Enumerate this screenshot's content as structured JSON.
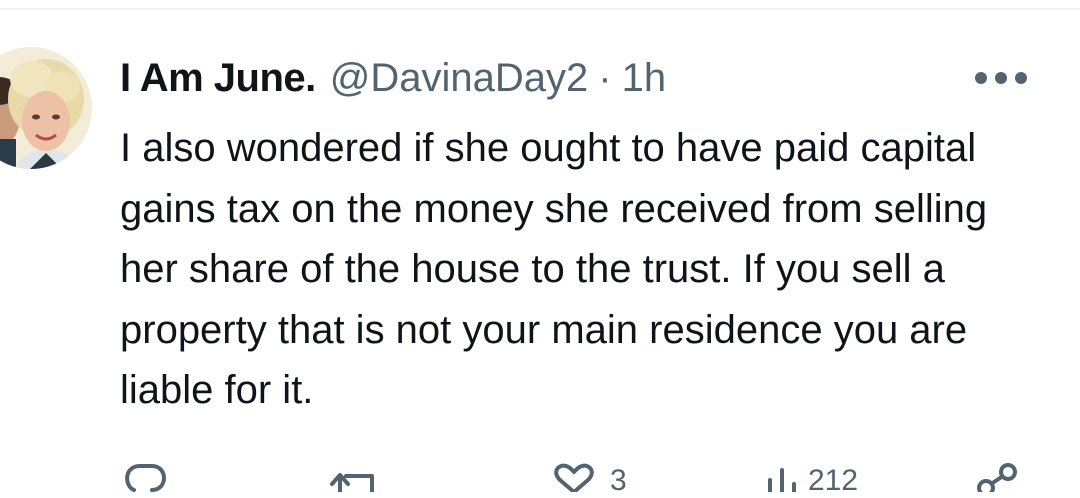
{
  "tweet": {
    "display_name": "I Am June.",
    "handle": "@DavinaDay2",
    "separator": "·",
    "time": "1h",
    "text": "I also wondered if she ought to have paid capital gains tax on the money she received from selling her share of the house to the trust. If you sell a property that is not your main residence you are liable for it."
  },
  "actions": {
    "reply_icon": "reply-icon",
    "retweet_icon": "retweet-icon",
    "like_icon": "heart-icon",
    "like_count": "3",
    "views_icon": "views-icon",
    "views_count": "212",
    "share_icon": "share-icon"
  },
  "colors": {
    "text": "#0f1419",
    "secondary": "#536471",
    "divider": "#eff3f4"
  }
}
